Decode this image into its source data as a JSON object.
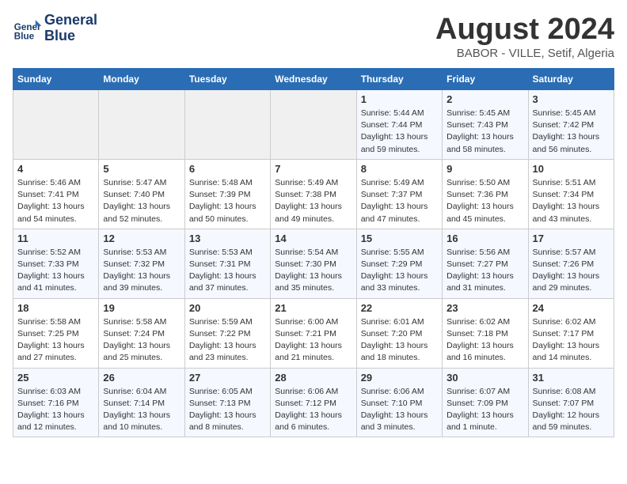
{
  "header": {
    "logo_line1": "General",
    "logo_line2": "Blue",
    "month_year": "August 2024",
    "location": "BABOR - VILLE, Setif, Algeria"
  },
  "weekdays": [
    "Sunday",
    "Monday",
    "Tuesday",
    "Wednesday",
    "Thursday",
    "Friday",
    "Saturday"
  ],
  "weeks": [
    [
      {
        "day": "",
        "empty": true
      },
      {
        "day": "",
        "empty": true
      },
      {
        "day": "",
        "empty": true
      },
      {
        "day": "",
        "empty": true
      },
      {
        "day": "1",
        "sunrise": "5:44 AM",
        "sunset": "7:44 PM",
        "daylight": "13 hours and 59 minutes."
      },
      {
        "day": "2",
        "sunrise": "5:45 AM",
        "sunset": "7:43 PM",
        "daylight": "13 hours and 58 minutes."
      },
      {
        "day": "3",
        "sunrise": "5:45 AM",
        "sunset": "7:42 PM",
        "daylight": "13 hours and 56 minutes."
      }
    ],
    [
      {
        "day": "4",
        "sunrise": "5:46 AM",
        "sunset": "7:41 PM",
        "daylight": "13 hours and 54 minutes."
      },
      {
        "day": "5",
        "sunrise": "5:47 AM",
        "sunset": "7:40 PM",
        "daylight": "13 hours and 52 minutes."
      },
      {
        "day": "6",
        "sunrise": "5:48 AM",
        "sunset": "7:39 PM",
        "daylight": "13 hours and 50 minutes."
      },
      {
        "day": "7",
        "sunrise": "5:49 AM",
        "sunset": "7:38 PM",
        "daylight": "13 hours and 49 minutes."
      },
      {
        "day": "8",
        "sunrise": "5:49 AM",
        "sunset": "7:37 PM",
        "daylight": "13 hours and 47 minutes."
      },
      {
        "day": "9",
        "sunrise": "5:50 AM",
        "sunset": "7:36 PM",
        "daylight": "13 hours and 45 minutes."
      },
      {
        "day": "10",
        "sunrise": "5:51 AM",
        "sunset": "7:34 PM",
        "daylight": "13 hours and 43 minutes."
      }
    ],
    [
      {
        "day": "11",
        "sunrise": "5:52 AM",
        "sunset": "7:33 PM",
        "daylight": "13 hours and 41 minutes."
      },
      {
        "day": "12",
        "sunrise": "5:53 AM",
        "sunset": "7:32 PM",
        "daylight": "13 hours and 39 minutes."
      },
      {
        "day": "13",
        "sunrise": "5:53 AM",
        "sunset": "7:31 PM",
        "daylight": "13 hours and 37 minutes."
      },
      {
        "day": "14",
        "sunrise": "5:54 AM",
        "sunset": "7:30 PM",
        "daylight": "13 hours and 35 minutes."
      },
      {
        "day": "15",
        "sunrise": "5:55 AM",
        "sunset": "7:29 PM",
        "daylight": "13 hours and 33 minutes."
      },
      {
        "day": "16",
        "sunrise": "5:56 AM",
        "sunset": "7:27 PM",
        "daylight": "13 hours and 31 minutes."
      },
      {
        "day": "17",
        "sunrise": "5:57 AM",
        "sunset": "7:26 PM",
        "daylight": "13 hours and 29 minutes."
      }
    ],
    [
      {
        "day": "18",
        "sunrise": "5:58 AM",
        "sunset": "7:25 PM",
        "daylight": "13 hours and 27 minutes."
      },
      {
        "day": "19",
        "sunrise": "5:58 AM",
        "sunset": "7:24 PM",
        "daylight": "13 hours and 25 minutes."
      },
      {
        "day": "20",
        "sunrise": "5:59 AM",
        "sunset": "7:22 PM",
        "daylight": "13 hours and 23 minutes."
      },
      {
        "day": "21",
        "sunrise": "6:00 AM",
        "sunset": "7:21 PM",
        "daylight": "13 hours and 21 minutes."
      },
      {
        "day": "22",
        "sunrise": "6:01 AM",
        "sunset": "7:20 PM",
        "daylight": "13 hours and 18 minutes."
      },
      {
        "day": "23",
        "sunrise": "6:02 AM",
        "sunset": "7:18 PM",
        "daylight": "13 hours and 16 minutes."
      },
      {
        "day": "24",
        "sunrise": "6:02 AM",
        "sunset": "7:17 PM",
        "daylight": "13 hours and 14 minutes."
      }
    ],
    [
      {
        "day": "25",
        "sunrise": "6:03 AM",
        "sunset": "7:16 PM",
        "daylight": "13 hours and 12 minutes."
      },
      {
        "day": "26",
        "sunrise": "6:04 AM",
        "sunset": "7:14 PM",
        "daylight": "13 hours and 10 minutes."
      },
      {
        "day": "27",
        "sunrise": "6:05 AM",
        "sunset": "7:13 PM",
        "daylight": "13 hours and 8 minutes."
      },
      {
        "day": "28",
        "sunrise": "6:06 AM",
        "sunset": "7:12 PM",
        "daylight": "13 hours and 6 minutes."
      },
      {
        "day": "29",
        "sunrise": "6:06 AM",
        "sunset": "7:10 PM",
        "daylight": "13 hours and 3 minutes."
      },
      {
        "day": "30",
        "sunrise": "6:07 AM",
        "sunset": "7:09 PM",
        "daylight": "13 hours and 1 minute."
      },
      {
        "day": "31",
        "sunrise": "6:08 AM",
        "sunset": "7:07 PM",
        "daylight": "12 hours and 59 minutes."
      }
    ]
  ]
}
